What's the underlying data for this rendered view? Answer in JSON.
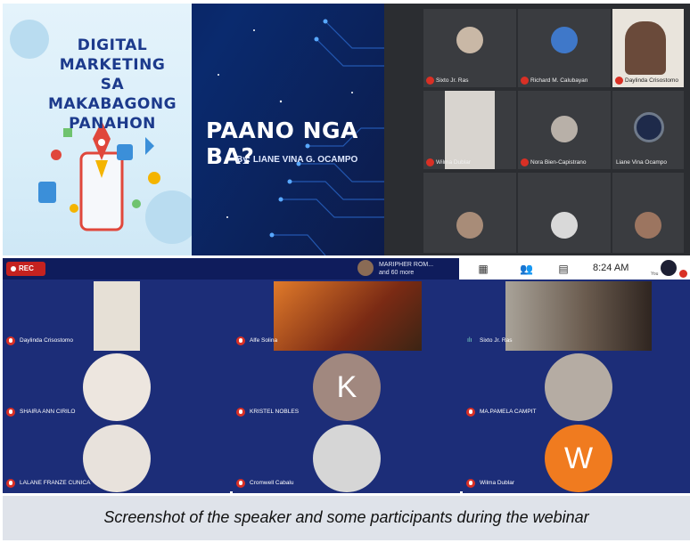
{
  "slide": {
    "title_lines": [
      "DIGITAL",
      "MARKETING",
      "SA MAKABAGONG",
      "PANAHON"
    ],
    "heading": "PAANO NGA BA?",
    "byline": "By: LIANE VINA G. OCAMPO"
  },
  "top_gallery": {
    "tiles": [
      {
        "name": "Sixto Jr. Ras"
      },
      {
        "name": "Richard M. Calubayan"
      },
      {
        "name": "Daylinda Crisostomo"
      },
      {
        "name": "Wilma Dublar"
      },
      {
        "name": "Nora Bien-Capistrano"
      },
      {
        "name": "Liane Vina Ocampo"
      },
      {
        "name": ""
      },
      {
        "name": ""
      },
      {
        "name": ""
      }
    ]
  },
  "meeting": {
    "rec_label": "REC",
    "presenter_line1": "MARIPHER ROM...",
    "presenter_line2": "and 60 more",
    "time": "8:24 AM",
    "you_label": "You",
    "colors": {
      "mic_muted": "#d93025",
      "background": "#1c2d78",
      "rec": "#c5221f"
    },
    "participants": [
      {
        "name": "Daylinda Crisostomo",
        "mic": "muted"
      },
      {
        "name": "Alfe Solina",
        "mic": "muted"
      },
      {
        "name": "Sixto Jr. Ras",
        "mic": "speaking"
      },
      {
        "name": "SHAIRA ANN CIRILO",
        "mic": "muted"
      },
      {
        "name": "KRISTEL NOBLES",
        "mic": "muted",
        "initial": "K"
      },
      {
        "name": "MA.PAMELA CAMPIT",
        "mic": "muted"
      },
      {
        "name": "LALANE FRANZE CUNICA",
        "mic": "muted"
      },
      {
        "name": "Cromwell Cabalu",
        "mic": "muted"
      },
      {
        "name": "Wilma Dublar",
        "mic": "muted",
        "initial": "W"
      }
    ]
  },
  "caption": "Screenshot of the speaker and some participants during the webinar"
}
